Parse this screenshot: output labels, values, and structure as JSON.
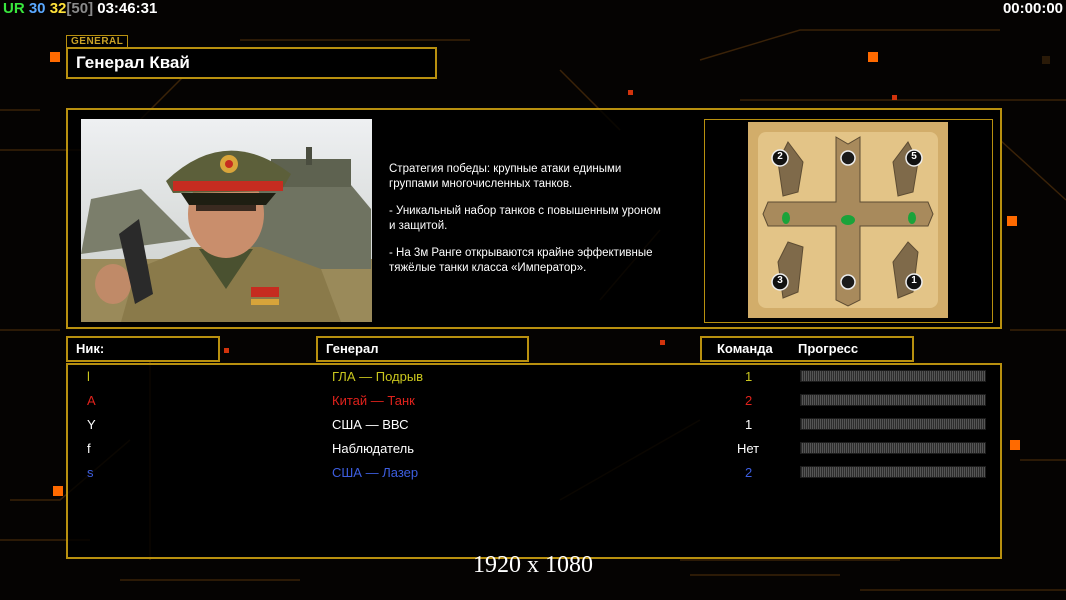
{
  "hud": {
    "faction": "UR",
    "count_a": "30",
    "count_b": "32",
    "limit": "[50]",
    "clock": "03:46:31",
    "timer": "00:00:00"
  },
  "general": {
    "tag": "GENERAL",
    "name": "Генерал Квай",
    "description": [
      "Стратегия победы: крупные атаки едиными\n группами многочисленных танков.",
      "- Уникальный набор танков с повышенным уроном\n и защитой.",
      "- На 3м Ранге открываются крайне эффективные\n тяжёлые танки класса «Император»."
    ]
  },
  "map": {
    "spawns": [
      "2",
      "5",
      "3",
      "1"
    ]
  },
  "table": {
    "headers": {
      "nick": "Ник:",
      "general": "Генерал",
      "team": "Команда",
      "progress": "Прогресс"
    },
    "players": [
      {
        "nick": "l",
        "general": "ГЛА — Подрыв",
        "team": "1",
        "color": "#c9c61e",
        "progress": 0
      },
      {
        "nick": "A",
        "general": "Китай — Танк",
        "team": "2",
        "color": "#e0221c",
        "progress": 0
      },
      {
        "nick": "Y",
        "general": "США — ВВС",
        "team": "1",
        "color": "#ffffff",
        "progress": 0
      },
      {
        "nick": "f",
        "general": "Наблюдатель",
        "team": "Нет",
        "color": "#ffffff",
        "progress": 0
      },
      {
        "nick": "s",
        "general": "США — Лазер",
        "team": "2",
        "color": "#3d5ee0",
        "progress": 0
      }
    ]
  },
  "resolution": "1920 x 1080",
  "colors": {
    "accent": "#b8900f",
    "hud_green": "#39e83d",
    "hud_blue": "#5aa8ff",
    "hud_yellow": "#ffe23a"
  }
}
